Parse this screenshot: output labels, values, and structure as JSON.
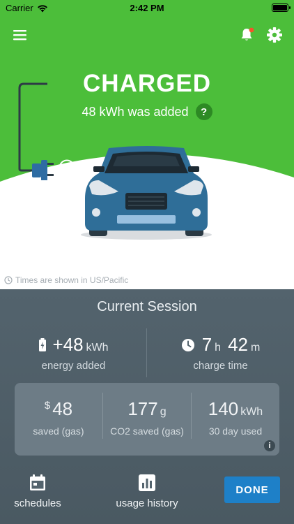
{
  "status_bar": {
    "carrier": "Carrier",
    "time": "2:42 PM"
  },
  "header": {
    "status_title": "CHARGED",
    "energy_message": "48 kWh was added",
    "help_label": "?"
  },
  "timezone_note": "Times are shown in US/Pacific",
  "session": {
    "title": "Current Session",
    "energy": {
      "value": "+48",
      "unit": "kWh",
      "label": "energy added"
    },
    "charge_time": {
      "hours": "7",
      "hours_unit": "h",
      "minutes": "42",
      "minutes_unit": "m",
      "label": "charge time"
    },
    "savings": [
      {
        "prefix": "$",
        "value": "48",
        "unit": "",
        "label": "saved (gas)"
      },
      {
        "prefix": "",
        "value": "177",
        "unit": "g",
        "label": "CO2 saved (gas)"
      },
      {
        "prefix": "",
        "value": "140",
        "unit": "kWh",
        "label": "30 day used"
      }
    ],
    "info_label": "i"
  },
  "bottom_nav": {
    "schedules_label": "schedules",
    "usage_history_label": "usage history",
    "done_label": "DONE"
  },
  "colors": {
    "accent_green": "#4cbe3a",
    "panel_slate": "#53636d",
    "done_blue": "#1e80c8",
    "car_blue": "#2f6e98",
    "notification_dot": "#f5542a"
  },
  "icons": [
    "wifi-icon",
    "battery-icon",
    "menu-icon",
    "bell-icon",
    "gear-icon",
    "help-icon",
    "plug-icon",
    "check-circle-icon",
    "car-illustration",
    "clock-icon",
    "battery-charge-icon",
    "calendar-icon",
    "bar-chart-icon",
    "info-icon"
  ]
}
